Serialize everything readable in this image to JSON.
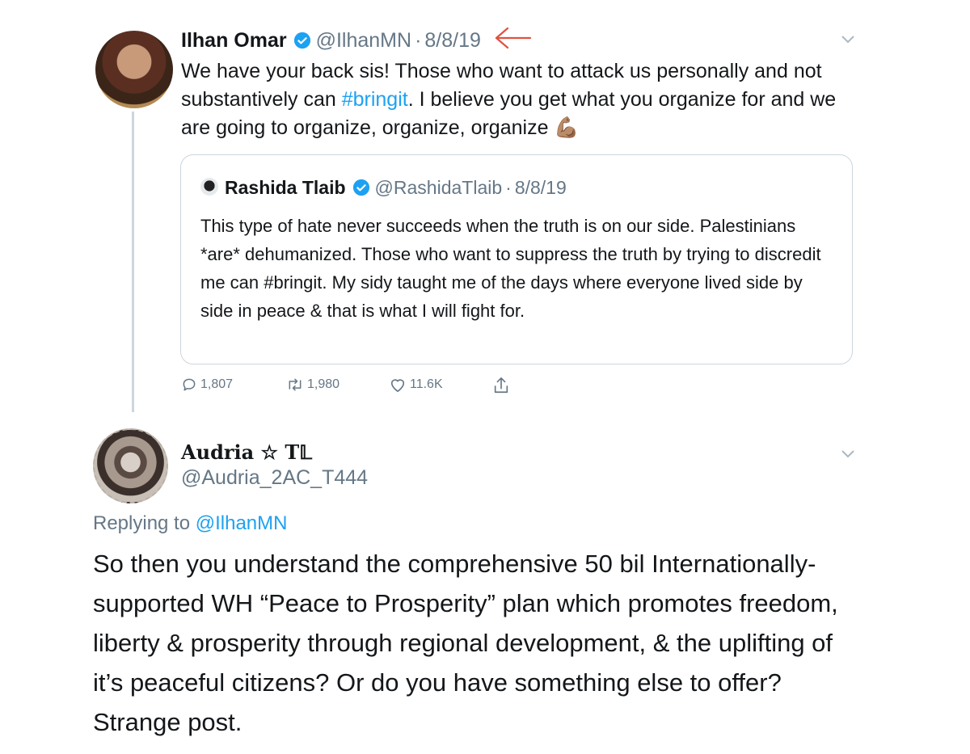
{
  "tweet1": {
    "name": "Ilhan Omar",
    "handle": "@IlhanMN",
    "separator": "·",
    "date": "8/8/19",
    "text_before_hashtag": "We have your back sis! Those who want to attack us personally and not substantively can ",
    "hashtag": "#bringit",
    "text_after_hashtag": ". I believe you get what you organize for and we are going to organize, organize, organize",
    "emoji": "💪🏽",
    "quote": {
      "name": "Rashida Tlaib",
      "handle": "@RashidaTlaib",
      "separator": "·",
      "date": "8/8/19",
      "text": "This type of hate never succeeds when the truth is on our side. Palestinians *are* dehumanized. Those who want to suppress the truth by trying to discredit me can #bringit. My sidy taught me of the days where everyone lived side by side in peace & that is what I will fight for."
    },
    "actions": {
      "replies": "1,807",
      "retweets": "1,980",
      "likes": "11.6K"
    }
  },
  "tweet2": {
    "name": "Audria ☆ T𝕃",
    "handle": "@Audria_2AC_T444",
    "replying_label": "Replying to",
    "replying_to": "@IlhanMN",
    "text": "So then you understand the comprehensive 50 bil Internationally-supported WH “Peace to Prosperity” plan which promotes freedom, liberty & prosperity through regional development, & the uplifting of it’s peaceful citizens? Or do you have something else to offer? Strange post."
  },
  "colors": {
    "link": "#1da1f2",
    "secondary_text": "#657786",
    "border": "#ccd6dd",
    "annotation_arrow": "#e0523f"
  }
}
